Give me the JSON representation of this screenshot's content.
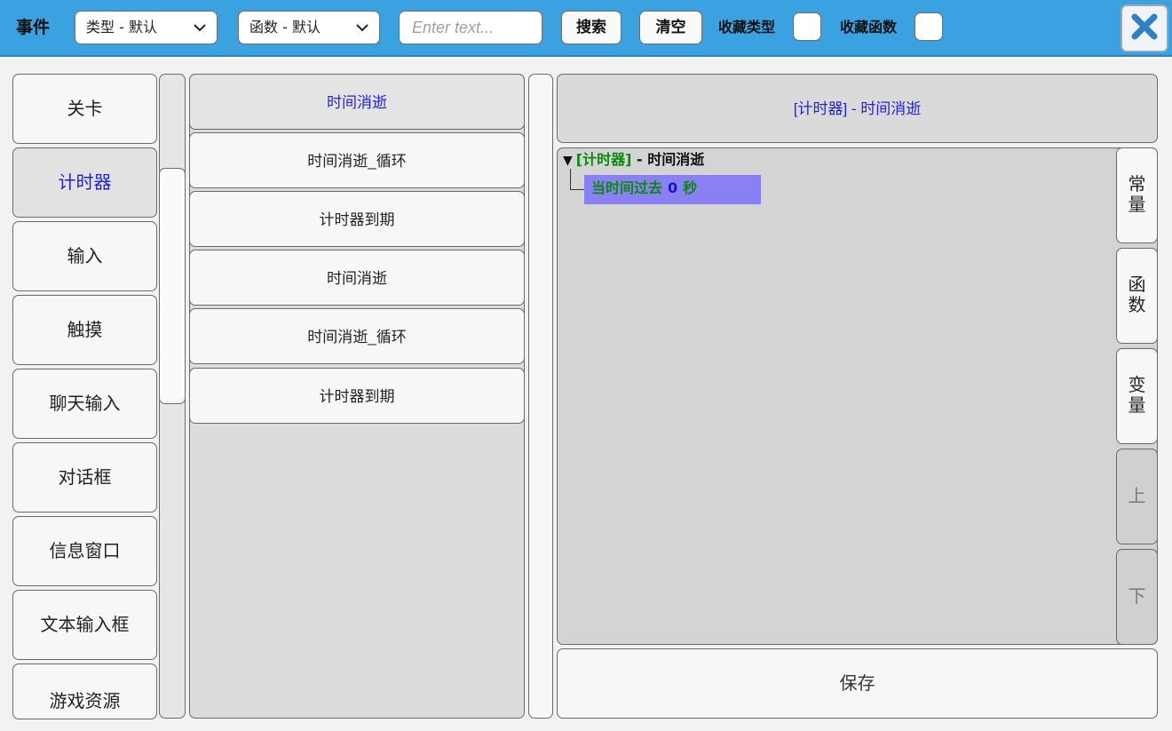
{
  "header": {
    "title": "事件",
    "type_dropdown": "类型 - 默认",
    "function_dropdown": "函数 - 默认",
    "search_placeholder": "Enter text...",
    "search_button": "搜索",
    "clear_button": "清空",
    "fav_type_label": "收藏类型",
    "fav_function_label": "收藏函数"
  },
  "categories": [
    {
      "label": "关卡",
      "selected": false
    },
    {
      "label": "计时器",
      "selected": true
    },
    {
      "label": "输入",
      "selected": false
    },
    {
      "label": "触摸",
      "selected": false
    },
    {
      "label": "聊天输入",
      "selected": false
    },
    {
      "label": "对话框",
      "selected": false
    },
    {
      "label": "信息窗口",
      "selected": false
    },
    {
      "label": "文本输入框",
      "selected": false
    },
    {
      "label": "游戏资源",
      "selected": false
    }
  ],
  "functions": [
    {
      "label": "时间消逝",
      "selected": true
    },
    {
      "label": "时间消逝_循环",
      "selected": false
    },
    {
      "label": "计时器到期",
      "selected": false
    },
    {
      "label": "时间消逝",
      "selected": false
    },
    {
      "label": "时间消逝_循环",
      "selected": false
    },
    {
      "label": "计时器到期",
      "selected": false
    }
  ],
  "editor": {
    "header": "[计时器] - 时间消逝",
    "tree_root": {
      "triangle": "▼",
      "class": "[计时器]",
      "separator": " - ",
      "name": "时间消逝"
    },
    "tree_node": {
      "prefix": "当时间过去",
      "value": "0",
      "suffix": "秒"
    }
  },
  "side_tabs": {
    "constants": [
      "常",
      "量"
    ],
    "functions": [
      "函",
      "数"
    ],
    "variables": [
      "变",
      "量"
    ],
    "up": [
      "上"
    ],
    "down": [
      "下"
    ]
  },
  "save_button": "保存",
  "colors": {
    "topbar": "#3aa2e0",
    "selected_text": "#2222dd",
    "tree_class": "#0a8a0a",
    "tree_highlight": "#8a80f5",
    "close_icon": "#2e7fc4"
  }
}
